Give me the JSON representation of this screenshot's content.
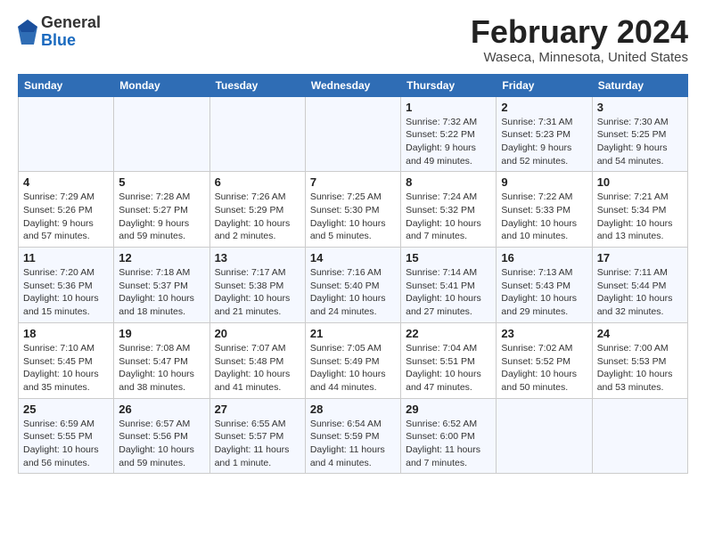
{
  "logo": {
    "general": "General",
    "blue": "Blue"
  },
  "header": {
    "title": "February 2024",
    "subtitle": "Waseca, Minnesota, United States"
  },
  "weekdays": [
    "Sunday",
    "Monday",
    "Tuesday",
    "Wednesday",
    "Thursday",
    "Friday",
    "Saturday"
  ],
  "weeks": [
    [
      {
        "day": "",
        "info": ""
      },
      {
        "day": "",
        "info": ""
      },
      {
        "day": "",
        "info": ""
      },
      {
        "day": "",
        "info": ""
      },
      {
        "day": "1",
        "info": "Sunrise: 7:32 AM\nSunset: 5:22 PM\nDaylight: 9 hours\nand 49 minutes."
      },
      {
        "day": "2",
        "info": "Sunrise: 7:31 AM\nSunset: 5:23 PM\nDaylight: 9 hours\nand 52 minutes."
      },
      {
        "day": "3",
        "info": "Sunrise: 7:30 AM\nSunset: 5:25 PM\nDaylight: 9 hours\nand 54 minutes."
      }
    ],
    [
      {
        "day": "4",
        "info": "Sunrise: 7:29 AM\nSunset: 5:26 PM\nDaylight: 9 hours\nand 57 minutes."
      },
      {
        "day": "5",
        "info": "Sunrise: 7:28 AM\nSunset: 5:27 PM\nDaylight: 9 hours\nand 59 minutes."
      },
      {
        "day": "6",
        "info": "Sunrise: 7:26 AM\nSunset: 5:29 PM\nDaylight: 10 hours\nand 2 minutes."
      },
      {
        "day": "7",
        "info": "Sunrise: 7:25 AM\nSunset: 5:30 PM\nDaylight: 10 hours\nand 5 minutes."
      },
      {
        "day": "8",
        "info": "Sunrise: 7:24 AM\nSunset: 5:32 PM\nDaylight: 10 hours\nand 7 minutes."
      },
      {
        "day": "9",
        "info": "Sunrise: 7:22 AM\nSunset: 5:33 PM\nDaylight: 10 hours\nand 10 minutes."
      },
      {
        "day": "10",
        "info": "Sunrise: 7:21 AM\nSunset: 5:34 PM\nDaylight: 10 hours\nand 13 minutes."
      }
    ],
    [
      {
        "day": "11",
        "info": "Sunrise: 7:20 AM\nSunset: 5:36 PM\nDaylight: 10 hours\nand 15 minutes."
      },
      {
        "day": "12",
        "info": "Sunrise: 7:18 AM\nSunset: 5:37 PM\nDaylight: 10 hours\nand 18 minutes."
      },
      {
        "day": "13",
        "info": "Sunrise: 7:17 AM\nSunset: 5:38 PM\nDaylight: 10 hours\nand 21 minutes."
      },
      {
        "day": "14",
        "info": "Sunrise: 7:16 AM\nSunset: 5:40 PM\nDaylight: 10 hours\nand 24 minutes."
      },
      {
        "day": "15",
        "info": "Sunrise: 7:14 AM\nSunset: 5:41 PM\nDaylight: 10 hours\nand 27 minutes."
      },
      {
        "day": "16",
        "info": "Sunrise: 7:13 AM\nSunset: 5:43 PM\nDaylight: 10 hours\nand 29 minutes."
      },
      {
        "day": "17",
        "info": "Sunrise: 7:11 AM\nSunset: 5:44 PM\nDaylight: 10 hours\nand 32 minutes."
      }
    ],
    [
      {
        "day": "18",
        "info": "Sunrise: 7:10 AM\nSunset: 5:45 PM\nDaylight: 10 hours\nand 35 minutes."
      },
      {
        "day": "19",
        "info": "Sunrise: 7:08 AM\nSunset: 5:47 PM\nDaylight: 10 hours\nand 38 minutes."
      },
      {
        "day": "20",
        "info": "Sunrise: 7:07 AM\nSunset: 5:48 PM\nDaylight: 10 hours\nand 41 minutes."
      },
      {
        "day": "21",
        "info": "Sunrise: 7:05 AM\nSunset: 5:49 PM\nDaylight: 10 hours\nand 44 minutes."
      },
      {
        "day": "22",
        "info": "Sunrise: 7:04 AM\nSunset: 5:51 PM\nDaylight: 10 hours\nand 47 minutes."
      },
      {
        "day": "23",
        "info": "Sunrise: 7:02 AM\nSunset: 5:52 PM\nDaylight: 10 hours\nand 50 minutes."
      },
      {
        "day": "24",
        "info": "Sunrise: 7:00 AM\nSunset: 5:53 PM\nDaylight: 10 hours\nand 53 minutes."
      }
    ],
    [
      {
        "day": "25",
        "info": "Sunrise: 6:59 AM\nSunset: 5:55 PM\nDaylight: 10 hours\nand 56 minutes."
      },
      {
        "day": "26",
        "info": "Sunrise: 6:57 AM\nSunset: 5:56 PM\nDaylight: 10 hours\nand 59 minutes."
      },
      {
        "day": "27",
        "info": "Sunrise: 6:55 AM\nSunset: 5:57 PM\nDaylight: 11 hours\nand 1 minute."
      },
      {
        "day": "28",
        "info": "Sunrise: 6:54 AM\nSunset: 5:59 PM\nDaylight: 11 hours\nand 4 minutes."
      },
      {
        "day": "29",
        "info": "Sunrise: 6:52 AM\nSunset: 6:00 PM\nDaylight: 11 hours\nand 7 minutes."
      },
      {
        "day": "",
        "info": ""
      },
      {
        "day": "",
        "info": ""
      }
    ]
  ]
}
